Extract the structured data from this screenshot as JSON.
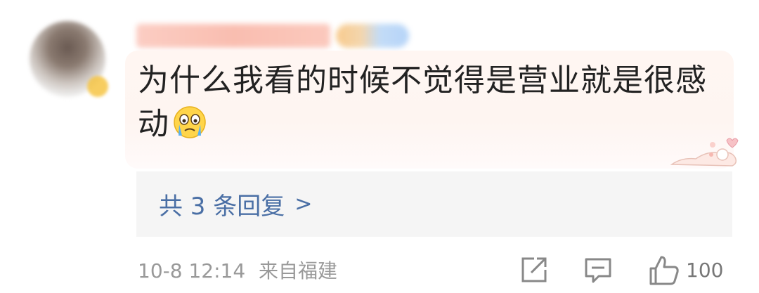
{
  "comment": {
    "text": "为什么我看的时候不觉得是营业就是很感动",
    "emoji": "crying-face"
  },
  "replies": {
    "label": "共 3 条回复",
    "chevron": ">"
  },
  "meta": {
    "timestamp": "10-8 12:14",
    "location": "来自福建"
  },
  "actions": {
    "like_count": "100",
    "icons": [
      "share-icon",
      "comment-icon",
      "like-icon"
    ]
  },
  "colors": {
    "link": "#4a6fa5",
    "meta": "#999999",
    "bubble": "#fff6f2",
    "replies_bg": "#f5f5f5"
  }
}
